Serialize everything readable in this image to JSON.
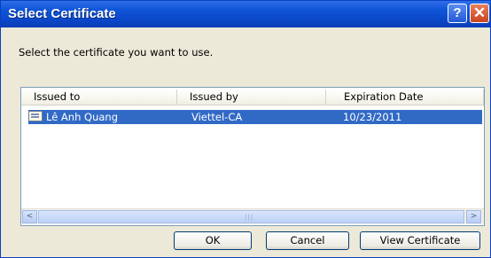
{
  "window": {
    "title": "Select Certificate",
    "help_label": "?",
    "close_label": "✕"
  },
  "prompt": "Select the certificate you want to use.",
  "table": {
    "columns": [
      "Issued to",
      "Issued by",
      "Expiration Date"
    ],
    "rows": [
      {
        "issued_to": "Lê Anh Quang",
        "issued_by": "Viettel-CA",
        "expiration": "10/23/2011",
        "selected": true
      }
    ]
  },
  "scrollbar": {
    "left_label": "<",
    "right_label": ">",
    "grip": "|||"
  },
  "buttons": {
    "ok": "OK",
    "cancel": "Cancel",
    "view": "View Certificate"
  },
  "colors": {
    "titlebar": "#0b48c9",
    "selection": "#316ac5",
    "dialog_bg": "#ece9d8"
  }
}
